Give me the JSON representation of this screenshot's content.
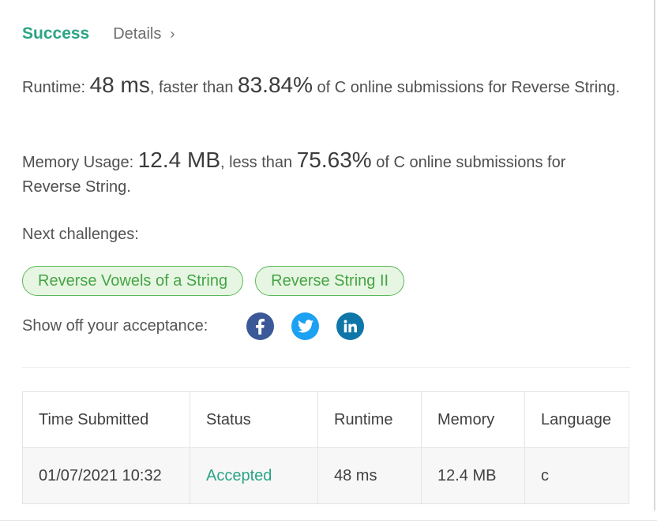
{
  "header": {
    "status": "Success",
    "details_label": "Details",
    "details_chevron": "›"
  },
  "runtime": {
    "label": "Runtime: ",
    "value": "48 ms",
    "comparison": ", faster than ",
    "percent": "83.84%",
    "suffix": " of C online submissions for Reverse String."
  },
  "memory": {
    "label": "Memory Usage: ",
    "value": "12.4 MB",
    "comparison": ", less than ",
    "percent": "75.63%",
    "suffix": " of C online submissions for Reverse String."
  },
  "next": {
    "label": "Next challenges:",
    "challenges": [
      "Reverse Vowels of a String",
      "Reverse String II"
    ]
  },
  "share": {
    "label": "Show off your acceptance:",
    "icons": [
      "facebook-icon",
      "twitter-icon",
      "linkedin-icon"
    ],
    "colors": {
      "facebook": "#3b5998",
      "twitter": "#1da1f2",
      "linkedin": "#0e76a8"
    }
  },
  "table": {
    "headers": [
      "Time Submitted",
      "Status",
      "Runtime",
      "Memory",
      "Language"
    ],
    "rows": [
      [
        "01/07/2021 10:32",
        "Accepted",
        "48 ms",
        "12.4 MB",
        "c"
      ]
    ]
  },
  "colors": {
    "accent": "#2aa584",
    "chip_border": "#5cb85c",
    "chip_bg": "#e7f6e3"
  }
}
